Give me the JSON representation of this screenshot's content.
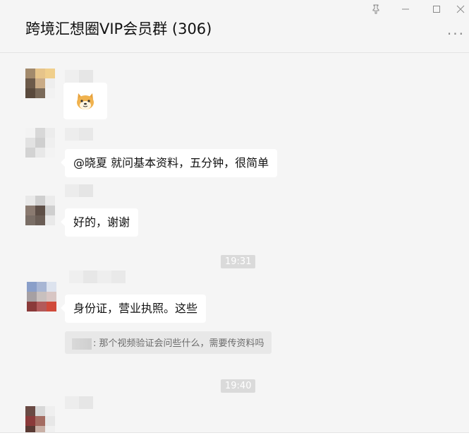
{
  "window": {
    "title": "跨境汇想圈VIP会员群 (306)",
    "controls": {
      "pin_icon": "pin-icon",
      "minimize_icon": "minimize-icon",
      "maximize_icon": "maximize-icon",
      "close_icon": "close-icon"
    },
    "more_label": "···"
  },
  "messages": [
    {
      "type": "sticker",
      "icon": "shiba-dog-sticker"
    },
    {
      "type": "text",
      "text": "@晓夏 就问基本资料，五分钟，很简单"
    },
    {
      "type": "text",
      "text": "好的，谢谢"
    },
    {
      "type": "time",
      "text": "19:31"
    },
    {
      "type": "text",
      "text": "身份证，营业执照。这些"
    },
    {
      "type": "quote",
      "text": ": 那个视频验证会问些什么，需要传资料吗"
    },
    {
      "type": "time",
      "text": "19:40"
    }
  ],
  "colors": {
    "background": "#f5f5f5",
    "bubble": "#ffffff",
    "timestamp_bg": "#dadada",
    "quote_bg": "#e8e8e8"
  }
}
